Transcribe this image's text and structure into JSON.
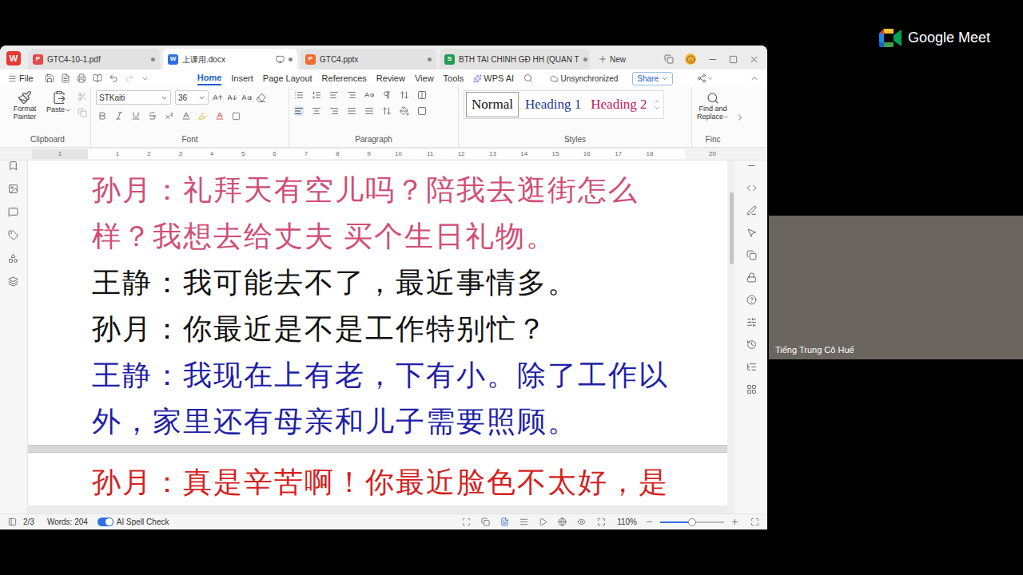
{
  "meet": {
    "brand": "Google Meet",
    "participant": "Tiếng Trung Cô Huế"
  },
  "app": {
    "logo": "W",
    "tabs": [
      {
        "label": "GTC4-10-1.pdf",
        "badge": "P",
        "color": "#e5484d",
        "selected": false
      },
      {
        "label": "上课用.docx",
        "badge": "W",
        "color": "#2f6fe4",
        "selected": true
      },
      {
        "label": "GTC4.pptx",
        "badge": "P",
        "color": "#f26b2b",
        "selected": false
      },
      {
        "label": "BTH TAI CHINH GĐ HH (QUAN T",
        "badge": "S",
        "color": "#1f9d55",
        "selected": false
      }
    ],
    "new_tab": "New",
    "menu": {
      "file": "File",
      "items": [
        {
          "label": "Home",
          "selected": true
        },
        {
          "label": "Insert",
          "selected": false
        },
        {
          "label": "Page Layout",
          "selected": false
        },
        {
          "label": "References",
          "selected": false
        },
        {
          "label": "Review",
          "selected": false
        },
        {
          "label": "View",
          "selected": false
        },
        {
          "label": "Tools",
          "selected": false
        }
      ],
      "ai": "WPS AI",
      "sync": "Unsynchronized",
      "share": "Share"
    },
    "ribbon": {
      "clipboard": {
        "format_painter": "Format Painter",
        "paste": "Paste",
        "label": "Clipboard"
      },
      "font": {
        "family": "STKaiti",
        "size": "36",
        "label": "Font"
      },
      "paragraph": {
        "label": "Paragraph"
      },
      "styles": {
        "label": "Styles",
        "items": [
          {
            "label": "Normal",
            "color": "#111111",
            "selected": true
          },
          {
            "label": "Heading 1",
            "color": "#1f3a93",
            "selected": false
          },
          {
            "label": "Heading 2",
            "color": "#c2185b",
            "selected": false
          }
        ]
      },
      "find": {
        "line1": "Find and",
        "line2": "Replace",
        "label": "Finc"
      }
    },
    "ruler": {
      "left": "1",
      "marks": [
        "1",
        "2",
        "3",
        "4",
        "5",
        "6",
        "7",
        "8",
        "9",
        "10",
        "11",
        "12",
        "13",
        "14",
        "15",
        "16",
        "17",
        "18"
      ],
      "right": "20"
    },
    "pages": [
      {
        "lines": [
          {
            "text": "孙月：礼拜天有空儿吗？陪我去逛街怎么",
            "color": "#d14d76"
          },
          {
            "text": "样？我想去给丈夫 买个生日礼物。",
            "color": "#d14d76"
          },
          {
            "text": "王静：我可能去不了，最近事情多。",
            "color": "#111111"
          },
          {
            "text": "孙月：你最近是不是工作特别忙？",
            "color": "#111111"
          },
          {
            "text": "王静：我现在上有老，下有小。除了工作以",
            "color": "#1f1fa8"
          },
          {
            "text": "外，家里还有母亲和儿子需要照顾。",
            "color": "#1f1fa8"
          }
        ]
      },
      {
        "lines": [
          {
            "text": "孙月：真是辛苦啊！你最近脸色不太好，是",
            "color": "#d61f1f"
          }
        ]
      }
    ],
    "status": {
      "page": "2/3",
      "words": "Words: 204",
      "spell": {
        "label": "AI Spell Check",
        "on": true
      },
      "zoom": {
        "reading": "110%",
        "level": 0.5
      }
    }
  }
}
